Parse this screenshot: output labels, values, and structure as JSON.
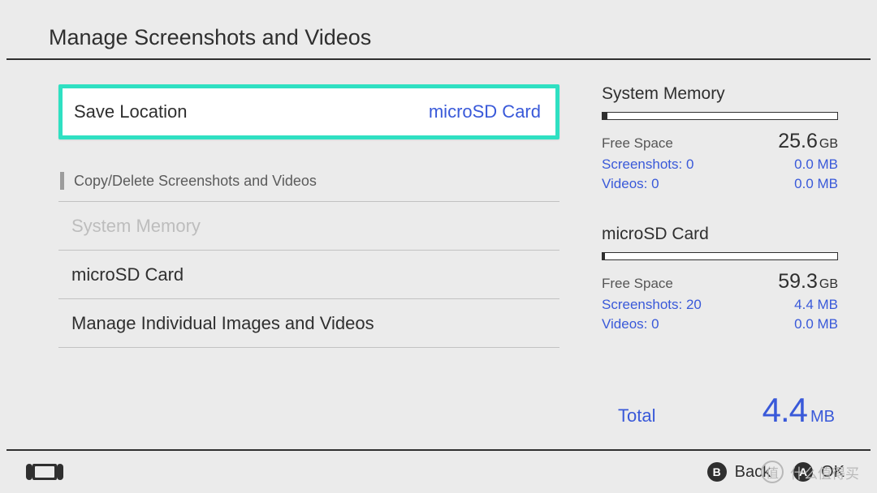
{
  "header": {
    "title": "Manage Screenshots and Videos"
  },
  "save_location": {
    "label": "Save Location",
    "value": "microSD Card"
  },
  "section": {
    "caption": "Copy/Delete Screenshots and Videos",
    "items": [
      {
        "label": "System Memory",
        "disabled": true
      },
      {
        "label": "microSD Card",
        "disabled": false
      },
      {
        "label": "Manage Individual Images and Videos",
        "disabled": false
      }
    ]
  },
  "storage": {
    "system_memory": {
      "title": "System Memory",
      "fill_pct": "2%",
      "free_label": "Free Space",
      "free_num": "25.6",
      "free_unit": "GB",
      "screenshots_k": "Screenshots: 0",
      "screenshots_v": "0.0 MB",
      "videos_k": "Videos: 0",
      "videos_v": "0.0 MB"
    },
    "microsd": {
      "title": "microSD Card",
      "fill_pct": "1%",
      "free_label": "Free Space",
      "free_num": "59.3",
      "free_unit": "GB",
      "screenshots_k": "Screenshots: 20",
      "screenshots_v": "4.4 MB",
      "videos_k": "Videos: 0",
      "videos_v": "0.0 MB"
    }
  },
  "total": {
    "label": "Total",
    "num": "4.4",
    "unit": "MB"
  },
  "footer": {
    "b_glyph": "B",
    "b_label": "Back",
    "a_glyph": "A",
    "a_label": "OK"
  },
  "watermark": {
    "text": "什么值得买"
  }
}
